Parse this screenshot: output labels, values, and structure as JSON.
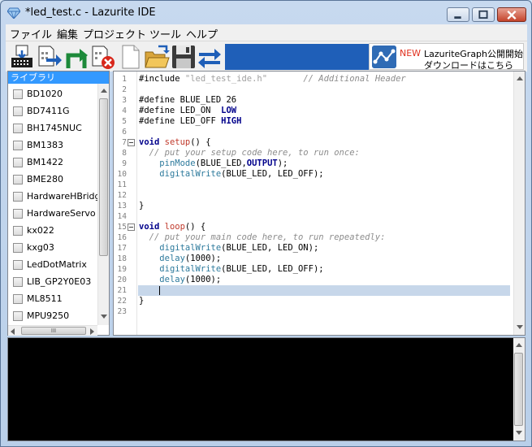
{
  "window": {
    "title": "*led_test.c - Lazurite IDE"
  },
  "menu": [
    "ファイル",
    "編集",
    "プロジェクト",
    "ツール",
    "ヘルプ"
  ],
  "toolbar": {
    "buttons": [
      "board-select-icon",
      "build-icon",
      "upload-icon",
      "stop-icon",
      "new-file-icon",
      "open-folder-icon",
      "save-icon",
      "switch-icon"
    ]
  },
  "banner": {
    "new_label": "NEW",
    "line1": "LazuriteGraph公開開始",
    "line2": "ダウンロードはこちら"
  },
  "library": {
    "header": "ライブラリ",
    "items": [
      "BD1020",
      "BD7411G",
      "BH1745NUC",
      "BM1383",
      "BM1422",
      "BME280",
      "HardwareHBridge",
      "HardwareServo",
      "kx022",
      "kxg03",
      "LedDotMatrix",
      "LIB_GP2Y0E03",
      "ML8511",
      "MPU9250"
    ],
    "hscroll_label": "III"
  },
  "editor": {
    "line_numbers": [
      "1",
      "2",
      "3",
      "4",
      "5",
      "6",
      "7",
      "8",
      "9",
      "10",
      "11",
      "12",
      "13",
      "14",
      "15",
      "16",
      "17",
      "18",
      "19",
      "20",
      "21",
      "22",
      "23"
    ],
    "lines": [
      "#include \"led_test_ide.h\"       // Additional Header",
      "",
      "#define BLUE_LED 26",
      "#define LED_ON  LOW",
      "#define LED_OFF HIGH",
      "",
      "void setup() {",
      "  // put your setup code here, to run once:",
      "    pinMode(BLUE_LED,OUTPUT);",
      "    digitalWrite(BLUE_LED, LED_OFF);",
      "",
      "",
      "}",
      "",
      "void loop() {",
      "  // put your main code here, to run repeatedly:",
      "    digitalWrite(BLUE_LED, LED_ON);",
      "    delay(1000);",
      "    digitalWrite(BLUE_LED, LED_OFF);",
      "    delay(1000);",
      "",
      "}",
      ""
    ],
    "folded_lines": [
      7,
      15
    ],
    "current_line": 21
  },
  "colors": {
    "selection": "#3399ff",
    "console_bg": "#000000",
    "current_line": "#c7d7ea"
  }
}
